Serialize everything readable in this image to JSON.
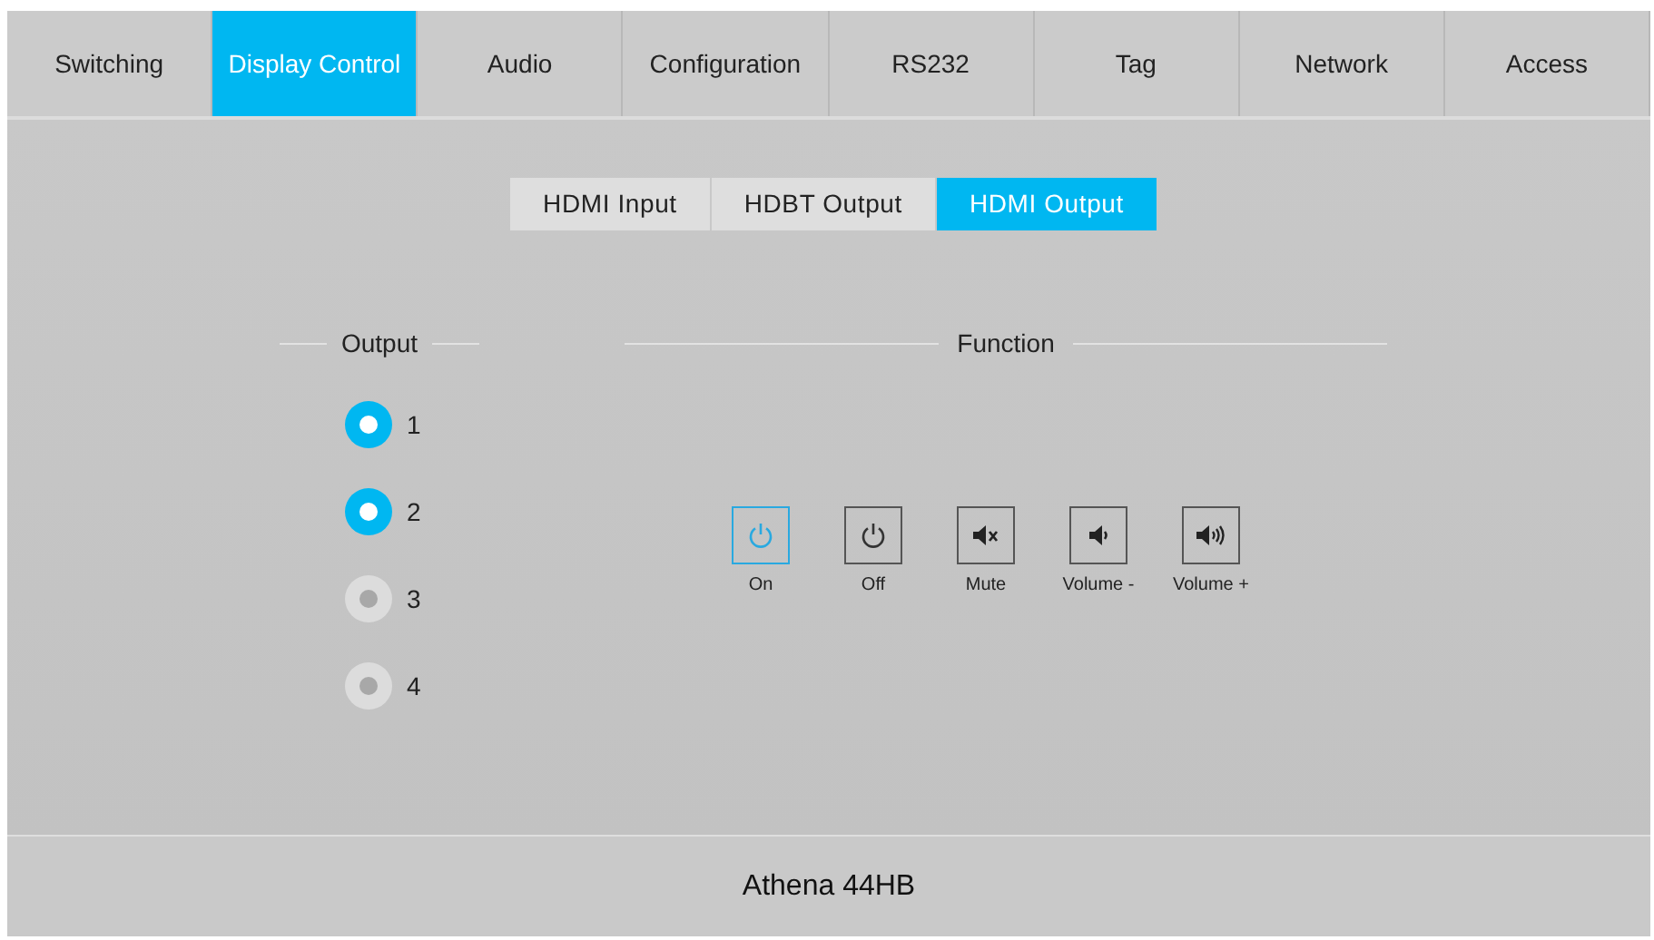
{
  "tabs": [
    {
      "label": "Switching",
      "selected": false
    },
    {
      "label": "Display Control",
      "selected": true
    },
    {
      "label": "Audio",
      "selected": false
    },
    {
      "label": "Configuration",
      "selected": false
    },
    {
      "label": "RS232",
      "selected": false
    },
    {
      "label": "Tag",
      "selected": false
    },
    {
      "label": "Network",
      "selected": false
    },
    {
      "label": "Access",
      "selected": false
    }
  ],
  "subtabs": [
    {
      "label": "HDMI Input",
      "selected": false
    },
    {
      "label": "HDBT Output",
      "selected": false
    },
    {
      "label": "HDMI Output",
      "selected": true
    }
  ],
  "output": {
    "title": "Output",
    "items": [
      {
        "label": "1",
        "selected": true
      },
      {
        "label": "2",
        "selected": true
      },
      {
        "label": "3",
        "selected": false
      },
      {
        "label": "4",
        "selected": false
      }
    ]
  },
  "function": {
    "title": "Function",
    "buttons": [
      {
        "label": "On",
        "kind": "power",
        "selected": true
      },
      {
        "label": "Off",
        "kind": "power",
        "selected": false
      },
      {
        "label": "Mute",
        "kind": "mute",
        "selected": false
      },
      {
        "label": "Volume -",
        "kind": "voldown",
        "selected": false
      },
      {
        "label": "Volume +",
        "kind": "volup",
        "selected": false
      }
    ]
  },
  "footer": {
    "title": "Athena 44HB"
  }
}
